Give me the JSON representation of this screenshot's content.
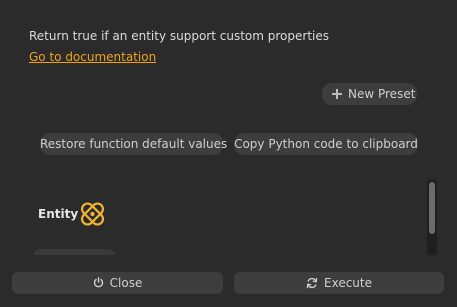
{
  "description": "Return true if an entity support custom properties",
  "documentation_link": "Go to documentation",
  "presets": {
    "new_preset_label": "New Preset",
    "icon": "plus-icon"
  },
  "actions": {
    "restore_label": "Restore function default values",
    "copy_label": "Copy Python code to clipboard"
  },
  "parameters": [
    {
      "label": "Entity",
      "icon": "entity-icon"
    }
  ],
  "footer": {
    "close_label": "Close",
    "close_icon": "power-icon",
    "execute_label": "Execute",
    "execute_icon": "refresh-icon"
  },
  "colors": {
    "background": "#2b2b2b",
    "accent": "#f2a31b",
    "button": "#3d3d3d"
  }
}
